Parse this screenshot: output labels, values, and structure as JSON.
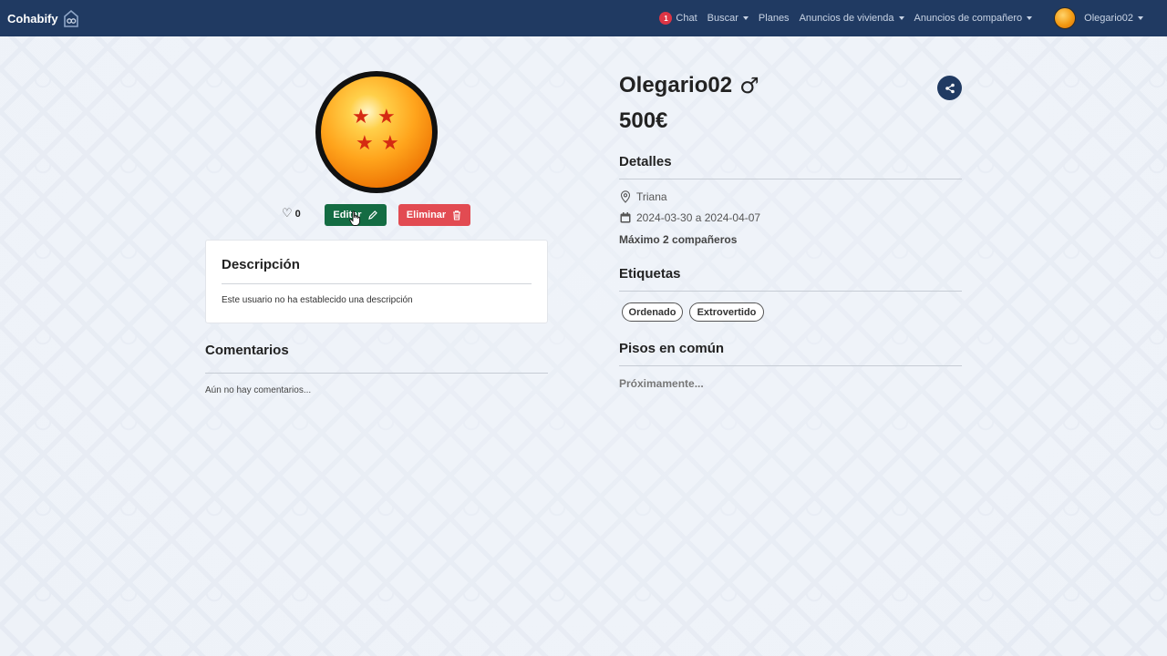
{
  "nav": {
    "brand": "Cohabify",
    "chat_badge": "1",
    "chat": "Chat",
    "buscar": "Buscar",
    "planes": "Planes",
    "anuncios_vivienda": "Anuncios de vivienda",
    "anuncios_companero": "Anuncios de compañero",
    "user": "Olegario02",
    "colors": {
      "navbar": "#203a62",
      "badge": "#dc3545"
    }
  },
  "profile": {
    "likes": "0",
    "edit_label": "Editar",
    "delete_label": "Eliminar",
    "name": "Olegario02",
    "gender_symbol": "♂",
    "price": "500€"
  },
  "description": {
    "title": "Descripción",
    "text": "Este usuario no ha establecido una descripción"
  },
  "comments": {
    "title": "Comentarios",
    "empty": "Aún no hay comentarios..."
  },
  "details": {
    "title": "Detalles",
    "location": "Triana",
    "dates": "2024-03-30 a 2024-04-07",
    "max_mates": "Máximo 2 compañeros"
  },
  "tags": {
    "title": "Etiquetas",
    "items": [
      "Ordenado",
      "Extrovertido"
    ]
  },
  "common_flats": {
    "title": "Pisos en común",
    "text": "Próximamente..."
  },
  "icons": [
    "cohabify-logo-icon",
    "heart-icon",
    "pencil-icon",
    "trash-icon",
    "share-icon",
    "map-pin-icon",
    "calendar-icon",
    "caret-down-icon",
    "cursor-hand-icon"
  ]
}
